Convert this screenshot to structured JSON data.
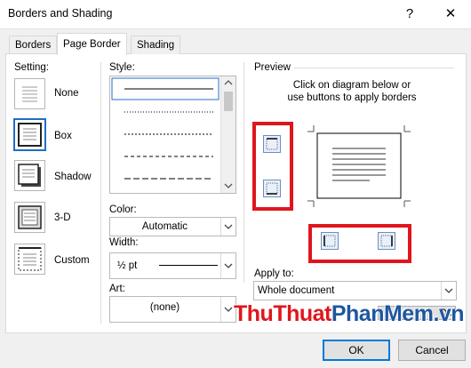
{
  "window": {
    "title": "Borders and Shading",
    "help": "?",
    "close": "✕"
  },
  "tabs": [
    {
      "label": "Borders"
    },
    {
      "label": "Page Border"
    },
    {
      "label": "Shading"
    }
  ],
  "setting": {
    "heading": "Setting:",
    "items": [
      {
        "label": "None"
      },
      {
        "label": "Box"
      },
      {
        "label": "Shadow"
      },
      {
        "label": "3-D"
      },
      {
        "label": "Custom"
      }
    ],
    "selected": "Box"
  },
  "style": {
    "heading": "Style:"
  },
  "color": {
    "heading": "Color:",
    "value": "Automatic"
  },
  "width": {
    "heading": "Width:",
    "value": "½ pt"
  },
  "art": {
    "heading": "Art:",
    "value": "(none)"
  },
  "preview": {
    "heading": "Preview",
    "hint1": "Click on diagram below or",
    "hint2": "use buttons to apply borders"
  },
  "apply_to": {
    "heading": "Apply to:",
    "value": "Whole document"
  },
  "options_button": "O...",
  "watermark": "ThuThuatPhanMem.vn",
  "buttons": {
    "ok": "OK",
    "cancel": "Cancel"
  },
  "colors": {
    "accent": "#0078d7",
    "highlight": "#e0161d",
    "watermark_red": "#e0161d",
    "watermark_blue": "#1e56a0"
  }
}
